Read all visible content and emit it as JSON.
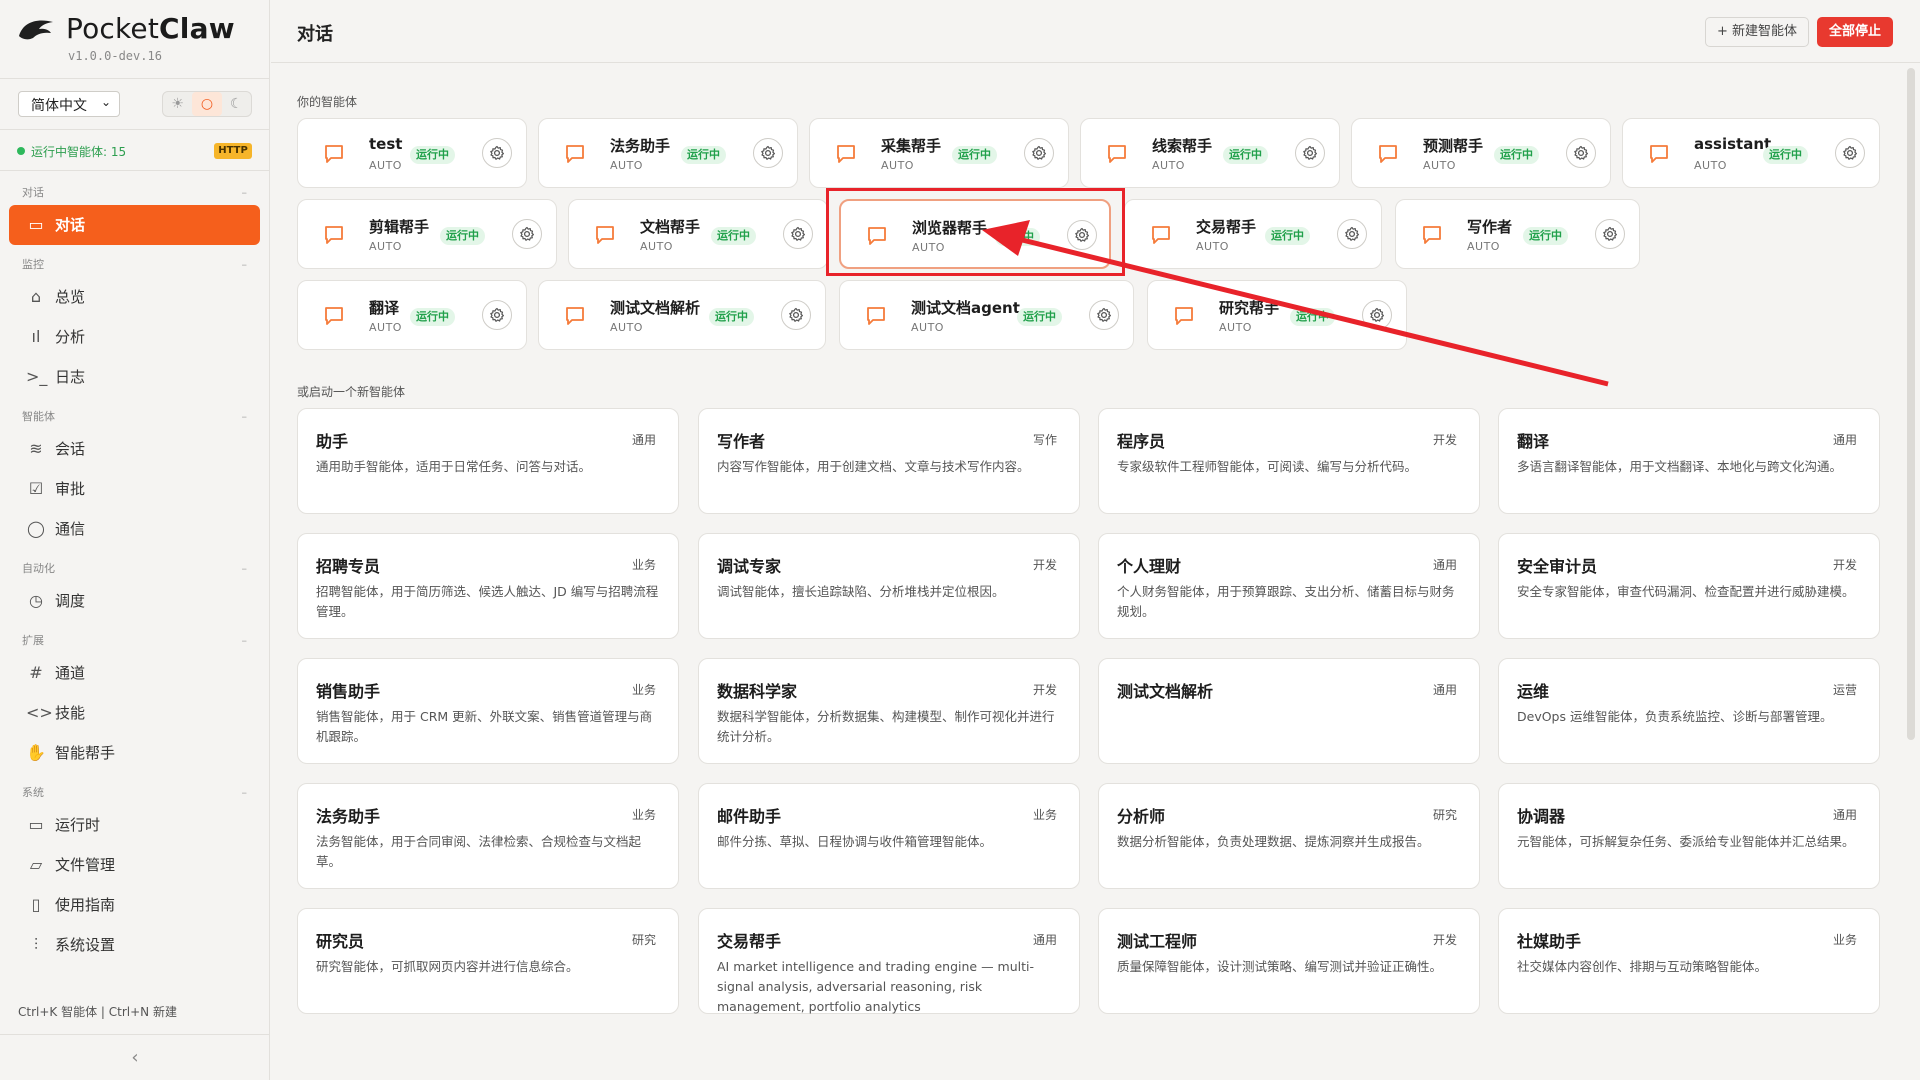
{
  "brand": {
    "name_a": "Pocket",
    "name_b": "Claw",
    "version": "v1.0.0-dev.16"
  },
  "lang": {
    "selected": "简体中文"
  },
  "theme": {
    "light": "☀",
    "system": "○",
    "dark": "☾"
  },
  "status": {
    "running": "运行中智能体: 15",
    "protocol": "HTTP"
  },
  "sidebar": {
    "sections": [
      {
        "title": "对话",
        "items": [
          {
            "label": "对话",
            "icon": "chat-icon"
          }
        ]
      },
      {
        "title": "监控",
        "items": [
          {
            "label": "总览",
            "icon": "home-icon"
          },
          {
            "label": "分析",
            "icon": "bar-chart-icon"
          },
          {
            "label": "日志",
            "icon": "terminal-icon"
          }
        ]
      },
      {
        "title": "智能体",
        "items": [
          {
            "label": "会话",
            "icon": "layers-icon"
          },
          {
            "label": "审批",
            "icon": "check-square-icon"
          },
          {
            "label": "通信",
            "icon": "message-icon"
          }
        ]
      },
      {
        "title": "自动化",
        "items": [
          {
            "label": "调度",
            "icon": "clock-icon"
          }
        ]
      },
      {
        "title": "扩展",
        "items": [
          {
            "label": "通道",
            "icon": "hash-icon"
          },
          {
            "label": "技能",
            "icon": "code-icon"
          },
          {
            "label": "智能帮手",
            "icon": "hand-icon"
          }
        ]
      },
      {
        "title": "系统",
        "items": [
          {
            "label": "运行时",
            "icon": "monitor-icon"
          },
          {
            "label": "文件管理",
            "icon": "folder-icon"
          },
          {
            "label": "使用指南",
            "icon": "book-icon"
          },
          {
            "label": "系统设置",
            "icon": "sliders-icon"
          }
        ]
      }
    ],
    "shortcut": "Ctrl+K 智能体 | Ctrl+N 新建",
    "collapse": "‹"
  },
  "header": {
    "title": "对话",
    "new_agent": "+ 新建智能体",
    "stop_all": "全部停止"
  },
  "agents_label": "你的智能体",
  "agent_running": "运行中",
  "agent_mode": "AUTO",
  "agents": [
    [
      "test",
      "法务助手",
      "采集帮手",
      "线索帮手",
      "预测帮手",
      "assistant"
    ],
    [
      "剪辑帮手",
      "文档帮手",
      "浏览器帮手",
      "交易帮手",
      "写作者"
    ],
    [
      "翻译",
      "测试文档解析",
      "测试文档agent",
      "研究帮手"
    ]
  ],
  "templates_label": "或启动一个新智能体",
  "templates": [
    [
      {
        "name": "助手",
        "tag": "通用",
        "desc": "通用助手智能体，适用于日常任务、问答与对话。"
      },
      {
        "name": "写作者",
        "tag": "写作",
        "desc": "内容写作智能体，用于创建文档、文章与技术写作内容。"
      },
      {
        "name": "程序员",
        "tag": "开发",
        "desc": "专家级软件工程师智能体，可阅读、编写与分析代码。"
      },
      {
        "name": "翻译",
        "tag": "通用",
        "desc": "多语言翻译智能体，用于文档翻译、本地化与跨文化沟通。"
      }
    ],
    [
      {
        "name": "招聘专员",
        "tag": "业务",
        "desc": "招聘智能体，用于简历筛选、候选人触达、JD 编写与招聘流程管理。"
      },
      {
        "name": "调试专家",
        "tag": "开发",
        "desc": "调试智能体，擅长追踪缺陷、分析堆栈并定位根因。"
      },
      {
        "name": "个人理财",
        "tag": "通用",
        "desc": "个人财务智能体，用于预算跟踪、支出分析、储蓄目标与财务规划。"
      },
      {
        "name": "安全审计员",
        "tag": "开发",
        "desc": "安全专家智能体，审查代码漏洞、检查配置并进行威胁建模。"
      }
    ],
    [
      {
        "name": "销售助手",
        "tag": "业务",
        "desc": "销售智能体，用于 CRM 更新、外联文案、销售管道管理与商机跟踪。"
      },
      {
        "name": "数据科学家",
        "tag": "开发",
        "desc": "数据科学智能体，分析数据集、构建模型、制作可视化并进行统计分析。"
      },
      {
        "name": "测试文档解析",
        "tag": "通用",
        "desc": ""
      },
      {
        "name": "运维",
        "tag": "运营",
        "desc": "DevOps 运维智能体，负责系统监控、诊断与部署管理。"
      }
    ],
    [
      {
        "name": "法务助手",
        "tag": "业务",
        "desc": "法务智能体，用于合同审阅、法律检索、合规检查与文档起草。"
      },
      {
        "name": "邮件助手",
        "tag": "业务",
        "desc": "邮件分拣、草拟、日程协调与收件箱管理智能体。"
      },
      {
        "name": "分析师",
        "tag": "研究",
        "desc": "数据分析智能体，负责处理数据、提炼洞察并生成报告。"
      },
      {
        "name": "协调器",
        "tag": "通用",
        "desc": "元智能体，可拆解复杂任务、委派给专业智能体并汇总结果。"
      }
    ],
    [
      {
        "name": "研究员",
        "tag": "研究",
        "desc": "研究智能体，可抓取网页内容并进行信息综合。"
      },
      {
        "name": "交易帮手",
        "tag": "通用",
        "desc": "AI market intelligence and trading engine — multi-signal analysis, adversarial reasoning, risk management, portfolio analytics"
      },
      {
        "name": "测试工程师",
        "tag": "开发",
        "desc": "质量保障智能体，设计测试策略、编写测试并验证正确性。"
      },
      {
        "name": "社媒助手",
        "tag": "业务",
        "desc": "社交媒体内容创作、排期与互动策略智能体。"
      }
    ]
  ],
  "colors": {
    "accent": "#f55f1c",
    "danger": "#e8392f",
    "running_bg": "#e3f6e8",
    "running_fg": "#20a04a",
    "annotation": "#e8232a"
  }
}
